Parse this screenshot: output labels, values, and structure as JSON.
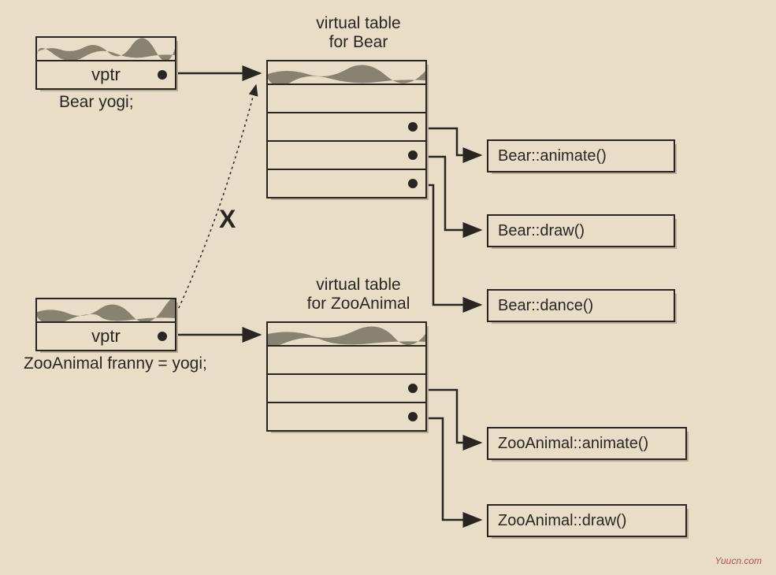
{
  "objects": {
    "yogi": {
      "vptr_label": "vptr",
      "caption": "Bear yogi;"
    },
    "franny": {
      "vptr_label": "vptr",
      "caption": "ZooAnimal franny = yogi;"
    }
  },
  "vtables": {
    "bear": {
      "title_line1": "virtual table",
      "title_line2": "for Bear"
    },
    "zooanimal": {
      "title_line1": "virtual table",
      "title_line2": "for ZooAnimal"
    }
  },
  "methods": {
    "bear_animate": "Bear::animate()",
    "bear_draw": "Bear::draw()",
    "bear_dance": "Bear::dance()",
    "zoo_animate": "ZooAnimal::animate()",
    "zoo_draw": "ZooAnimal::draw()"
  },
  "xmark": "X",
  "watermark": "Yuucn.com"
}
